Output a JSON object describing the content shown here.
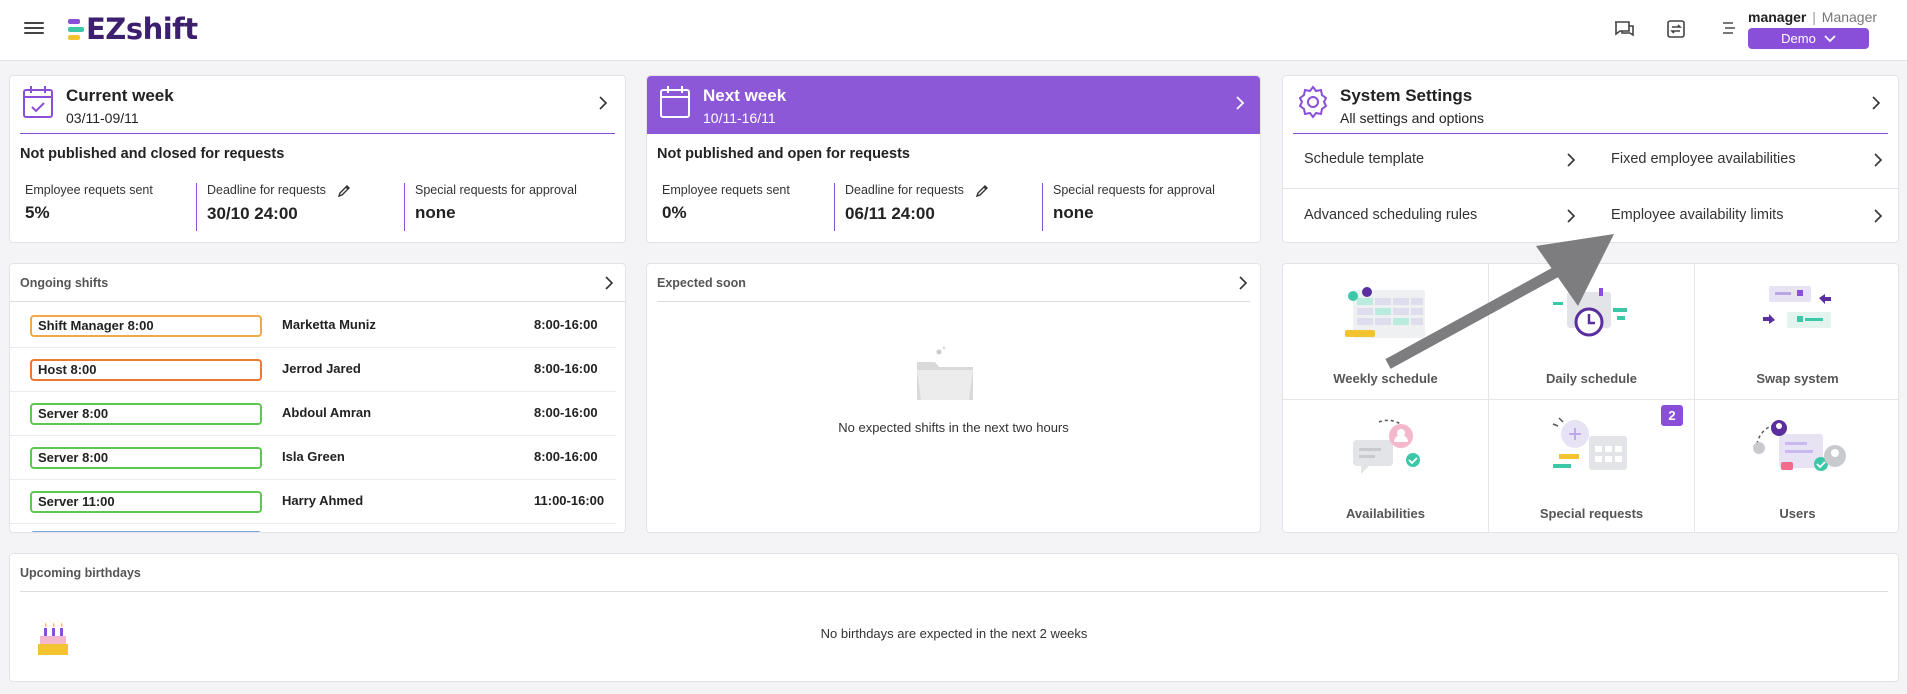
{
  "header": {
    "logo_text": "EZshift",
    "user_name": "manager",
    "user_sep": "|",
    "user_role": "Manager",
    "location": "Demo"
  },
  "current_week": {
    "title": "Current week",
    "range": "03/11-09/11",
    "status": "Not published and closed for requests",
    "stats": {
      "sent_label": "Employee requets sent",
      "sent_value": "5%",
      "deadline_label": "Deadline for requests",
      "deadline_value": "30/10 24:00",
      "special_label": "Special requests for approval",
      "special_value": "none"
    }
  },
  "next_week": {
    "title": "Next week",
    "range": "10/11-16/11",
    "status": "Not published and open for requests",
    "stats": {
      "sent_label": "Employee requets sent",
      "sent_value": "0%",
      "deadline_label": "Deadline for requests",
      "deadline_value": "06/11 24:00",
      "special_label": "Special requests for approval",
      "special_value": "none"
    }
  },
  "system_settings": {
    "title": "System Settings",
    "subtitle": "All settings and options",
    "links": [
      "Schedule template",
      "Fixed employee availabilities",
      "Advanced scheduling rules",
      "Employee availability limits"
    ]
  },
  "ongoing_shifts": {
    "title": "Ongoing shifts",
    "rows": [
      {
        "tag": "Shift Manager 8:00",
        "name": "Marketta Muniz",
        "time": "8:00-16:00",
        "color": "#f0a848"
      },
      {
        "tag": "Host 8:00",
        "name": "Jerrod Jared",
        "time": "8:00-16:00",
        "color": "#f07830"
      },
      {
        "tag": "Server 8:00",
        "name": "Abdoul Amran",
        "time": "8:00-16:00",
        "color": "#5cc850"
      },
      {
        "tag": "Server 8:00",
        "name": "Isla Green",
        "time": "8:00-16:00",
        "color": "#5cc850"
      },
      {
        "tag": "Server 11:00",
        "name": "Harry Ahmed",
        "time": "11:00-16:00",
        "color": "#5cc850"
      }
    ]
  },
  "expected_soon": {
    "title": "Expected soon",
    "empty_text": "No expected shifts in the next two hours"
  },
  "quick_tiles": [
    {
      "label": "Weekly schedule",
      "icon": "weekly-schedule-icon"
    },
    {
      "label": "Daily schedule",
      "icon": "daily-schedule-icon"
    },
    {
      "label": "Swap system",
      "icon": "swap-system-icon"
    },
    {
      "label": "Availabilities",
      "icon": "availabilities-icon"
    },
    {
      "label": "Special requests",
      "icon": "special-requests-icon",
      "badge": "2"
    },
    {
      "label": "Users",
      "icon": "users-icon"
    }
  ],
  "birthdays": {
    "title": "Upcoming birthdays",
    "empty_text": "No birthdays are expected in the next 2 weeks"
  },
  "colors": {
    "accent": "#8a4fd8",
    "header_purple": "#8d58d8"
  }
}
